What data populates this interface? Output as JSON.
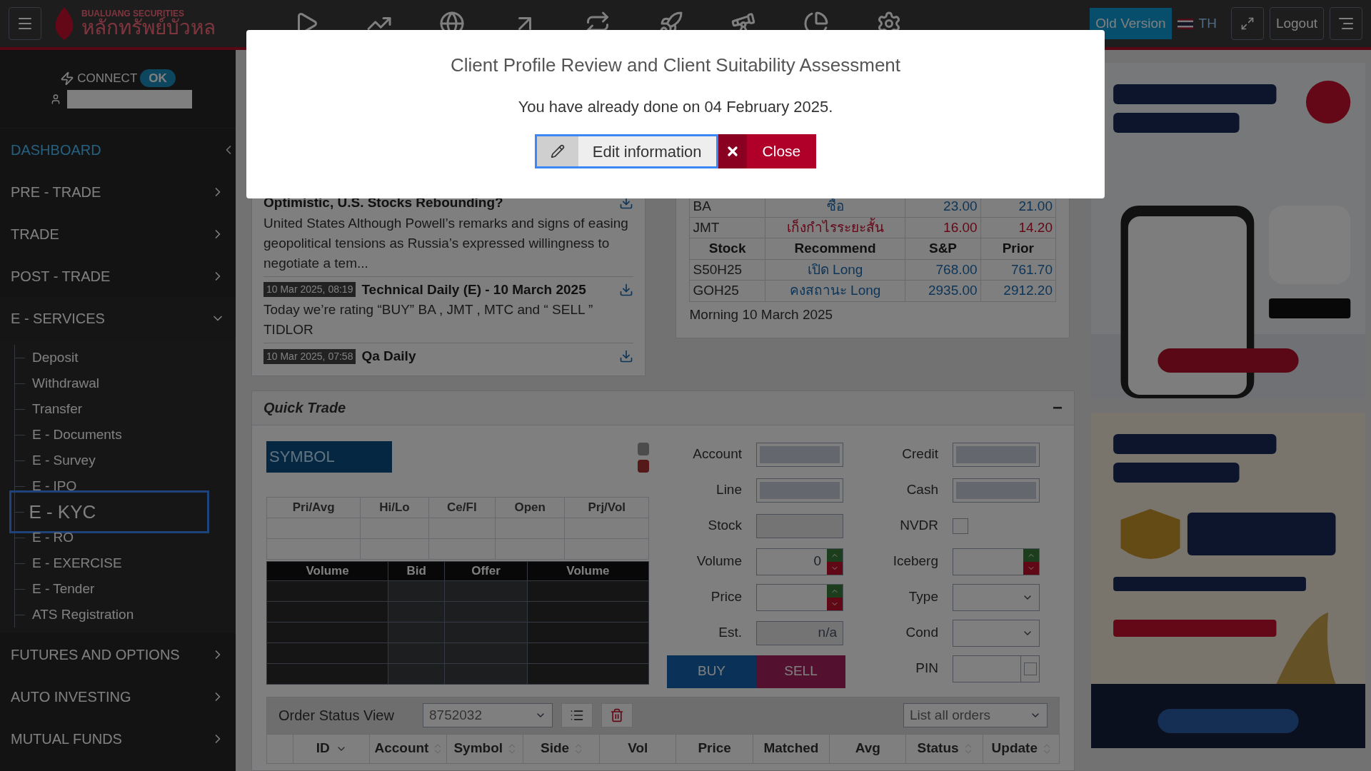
{
  "topbar": {
    "logo": {
      "latin": "BUALUANG SECURITIES",
      "thai": "หลักทรัพย์บัวหล"
    },
    "old_version": "Old Version",
    "language": "TH",
    "logout": "Logout"
  },
  "sidebar": {
    "connect_label": "CONNECT",
    "connect_status": "OK",
    "items": [
      {
        "label": "DASHBOARD",
        "selected": true,
        "expanded": false,
        "has_children": false
      },
      {
        "label": "PRE - TRADE",
        "selected": false,
        "expanded": false,
        "has_children": true
      },
      {
        "label": "TRADE",
        "selected": false,
        "expanded": false,
        "has_children": true
      },
      {
        "label": "POST - TRADE",
        "selected": false,
        "expanded": false,
        "has_children": true
      },
      {
        "label": "E - SERVICES",
        "selected": false,
        "expanded": true,
        "has_children": true,
        "children": [
          {
            "label": "Deposit",
            "selected": false
          },
          {
            "label": "Withdrawal",
            "selected": false
          },
          {
            "label": "Transfer",
            "selected": false
          },
          {
            "label": "E - Documents",
            "selected": false
          },
          {
            "label": "E - Survey",
            "selected": false
          },
          {
            "label": "E - IPO",
            "selected": false
          },
          {
            "label": "E - KYC",
            "selected": true
          },
          {
            "label": "E - RO",
            "selected": false
          },
          {
            "label": "E - EXERCISE",
            "selected": false
          },
          {
            "label": "E - Tender",
            "selected": false
          },
          {
            "label": "ATS Registration",
            "selected": false
          }
        ]
      },
      {
        "label": "FUTURES AND OPTIONS",
        "selected": false,
        "expanded": false,
        "has_children": true
      },
      {
        "label": "AUTO INVESTING",
        "selected": false,
        "expanded": false,
        "has_children": true
      },
      {
        "label": "MUTUAL FUNDS",
        "selected": false,
        "expanded": false,
        "has_children": true
      }
    ]
  },
  "news": [
    {
      "title": "Optimistic, U.S. Stocks Rebounding?",
      "body": "United States Although Powell’s remarks and signs of easing geopolitical tensions as Russia’s expressed willingness to negotiate a tem..."
    },
    {
      "date": "10 Mar 2025, 08:19",
      "title": "Technical Daily (E) - 10 March 2025",
      "body": "Today we’re rating “BUY”  BA , JMT , MTC and “ SELL ” TIDLOR"
    },
    {
      "date": "10 Mar 2025, 07:58",
      "title": "Qa Daily"
    }
  ],
  "recommend": {
    "top_rows": [
      [
        "BA",
        "ซื้อ",
        "23.00",
        "21.00"
      ],
      [
        "JMT",
        "เก็งกำไรระยะสั้น",
        "16.00",
        "14.20"
      ]
    ],
    "columns": [
      "Stock",
      "Recommend",
      "S&P",
      "Prior"
    ],
    "rows": [
      [
        "S50H25",
        "เปิด Long",
        "768.00",
        "761.70"
      ],
      [
        "GOH25",
        "คงสถานะ Long",
        "2935.00",
        "2912.20"
      ]
    ],
    "footer": "Morning 10 March 2025"
  },
  "quick_trade": {
    "title": "Quick Trade",
    "collapse": "−",
    "symbol_placeholder": "SYMBOL",
    "info_columns": [
      "Pri/Avg",
      "Hi/Lo",
      "Ce/Fl",
      "Open",
      "Prj/Vol"
    ],
    "depth_columns": [
      "Volume",
      "Bid",
      "Offer",
      "Volume"
    ],
    "form_left": [
      {
        "label": "Account",
        "kind": "masked"
      },
      {
        "label": "Line",
        "kind": "masked"
      },
      {
        "label": "Stock",
        "kind": "text"
      },
      {
        "label": "Volume",
        "kind": "spinner",
        "value": "0"
      },
      {
        "label": "Price",
        "kind": "spinner"
      },
      {
        "label": "Est.",
        "kind": "readonly",
        "value": "n/a"
      }
    ],
    "form_right": [
      {
        "label": "Credit",
        "kind": "masked"
      },
      {
        "label": "Cash",
        "kind": "masked"
      },
      {
        "label": "NVDR",
        "kind": "checkbox",
        "checked": false
      },
      {
        "label": "Iceberg",
        "kind": "spinner"
      },
      {
        "label": "Type",
        "kind": "select"
      },
      {
        "label": "Cond",
        "kind": "select"
      },
      {
        "label": "PIN",
        "kind": "pin",
        "checked": false
      }
    ],
    "buy": "BUY",
    "sell": "SELL",
    "order_status": {
      "title": "Order Status View",
      "account": "8752032",
      "filter": "List all orders",
      "columns": [
        {
          "label": "ID",
          "sortable": true,
          "sorted": true
        },
        {
          "label": "Account",
          "sortable": true,
          "sorted": false
        },
        {
          "label": "Symbol",
          "sortable": true,
          "sorted": false
        },
        {
          "label": "Side",
          "sortable": true,
          "sorted": false
        },
        {
          "label": "Vol",
          "sortable": false
        },
        {
          "label": "Price",
          "sortable": false
        },
        {
          "label": "Matched",
          "sortable": false
        },
        {
          "label": "Avg",
          "sortable": false
        },
        {
          "label": "Status",
          "sortable": true,
          "sorted": false
        },
        {
          "label": "Update",
          "sortable": true,
          "sorted": false
        }
      ]
    }
  },
  "modal": {
    "title": "Client Profile Review and Client Suitability Assessment",
    "message": "You have already done on 04 February 2025.",
    "edit_button": "Edit information",
    "close_button": "Close"
  }
}
